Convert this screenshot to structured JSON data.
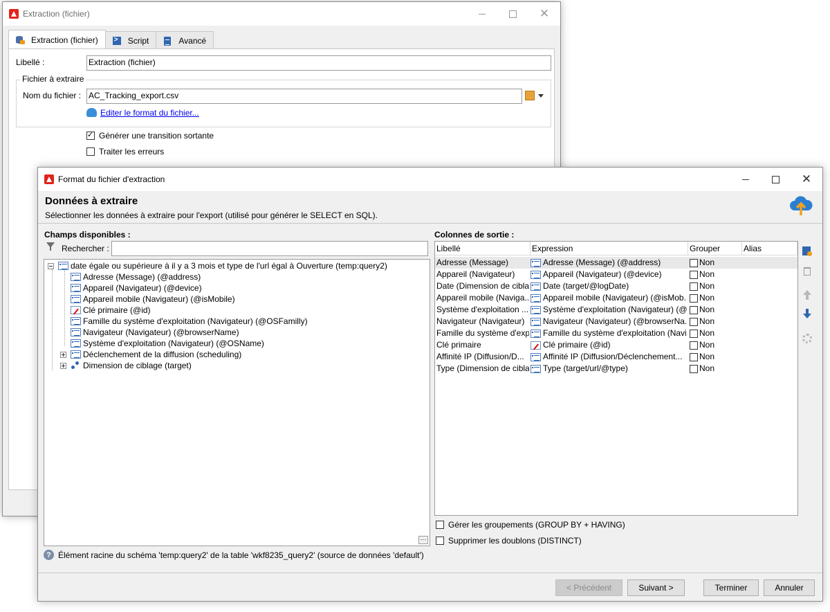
{
  "back_window": {
    "title": "Extraction (fichier)",
    "tabs": [
      {
        "label": "Extraction (fichier)",
        "icon": "database-icon"
      },
      {
        "label": "Script",
        "icon": "script-icon"
      },
      {
        "label": "Avancé",
        "icon": "clipboard-icon"
      }
    ],
    "libelle_label": "Libellé :",
    "libelle_value": "Extraction (fichier)",
    "group_title": "Fichier à extraire",
    "filename_label": "Nom du fichier :",
    "filename_value": "AC_Tracking_export.csv",
    "edit_format_link": "Editer le format du fichier...",
    "generate_transition_label": "Générer une transition sortante",
    "generate_transition_checked": true,
    "process_errors_label": "Traiter les erreurs",
    "process_errors_checked": false
  },
  "dialog": {
    "title": "Format du fichier d'extraction",
    "header_title": "Données à extraire",
    "header_subtitle": "Sélectionner les données à extraire pour l'export (utilisé pour générer le SELECT en SQL).",
    "available_fields_label": "Champs disponibles :",
    "search_label": "Rechercher :",
    "search_value": "",
    "tree": {
      "root": "date égale ou supérieure à il y a 3 mois et type de l'url égal à Ouverture (temp:query2)",
      "children": [
        {
          "label": "Adresse (Message) (@address)",
          "icon": "field-icon"
        },
        {
          "label": "Appareil (Navigateur) (@device)",
          "icon": "field-icon"
        },
        {
          "label": "Appareil mobile (Navigateur) (@isMobile)",
          "icon": "field-icon"
        },
        {
          "label": "Clé primaire (@id)",
          "icon": "primary-key-icon"
        },
        {
          "label": "Famille du système d'exploitation (Navigateur) (@OSFamilly)",
          "icon": "field-icon"
        },
        {
          "label": "Navigateur (Navigateur) (@browserName)",
          "icon": "field-icon"
        },
        {
          "label": "Système d'exploitation (Navigateur) (@OSName)",
          "icon": "field-icon"
        },
        {
          "label": "Déclenchement de la diffusion (scheduling)",
          "icon": "collection-icon"
        },
        {
          "label": "Dimension de ciblage (target)",
          "icon": "link-icon"
        }
      ]
    },
    "output_columns_label": "Colonnes de sortie :",
    "columns": [
      "Libellé",
      "Expression",
      "Grouper",
      "Alias"
    ],
    "rows": [
      {
        "libelle": "Adresse (Message)",
        "expression": "Adresse (Message) (@address)",
        "grouper": "Non",
        "alias": ""
      },
      {
        "libelle": "Appareil (Navigateur)",
        "expression": "Appareil (Navigateur) (@device)",
        "grouper": "Non",
        "alias": ""
      },
      {
        "libelle": "Date (Dimension de cibla...",
        "expression": "Date (target/@logDate)",
        "grouper": "Non",
        "alias": ""
      },
      {
        "libelle": "Appareil mobile (Naviga...",
        "expression": "Appareil mobile (Navigateur) (@isMob...",
        "grouper": "Non",
        "alias": ""
      },
      {
        "libelle": "Système d'exploitation ...",
        "expression": "Système d'exploitation (Navigateur) (@...",
        "grouper": "Non",
        "alias": ""
      },
      {
        "libelle": "Navigateur (Navigateur)",
        "expression": "Navigateur (Navigateur) (@browserNa...",
        "grouper": "Non",
        "alias": ""
      },
      {
        "libelle": "Famille du système d'expl...",
        "expression": "Famille du système d'exploitation (Navi...",
        "grouper": "Non",
        "alias": ""
      },
      {
        "libelle": "Clé primaire",
        "expression": "Clé primaire (@id)",
        "grouper": "Non",
        "alias": ""
      },
      {
        "libelle": "Affinité IP (Diffusion/D...",
        "expression": "Affinité IP (Diffusion/Déclenchement...",
        "grouper": "Non",
        "alias": ""
      },
      {
        "libelle": "Type (Dimension de cibla...",
        "expression": "Type (target/url/@type)",
        "grouper": "Non",
        "alias": ""
      }
    ],
    "manage_groupings_label": "Gérer les groupements (GROUP BY + HAVING)",
    "remove_duplicates_label": "Supprimer les doublons (DISTINCT)",
    "status_text": "Élément racine du schéma 'temp:query2' de la table 'wkf8235_query2' (source de données 'default')",
    "buttons": {
      "previous": "< Précédent",
      "next": "Suivant >",
      "finish": "Terminer",
      "cancel": "Annuler"
    }
  }
}
